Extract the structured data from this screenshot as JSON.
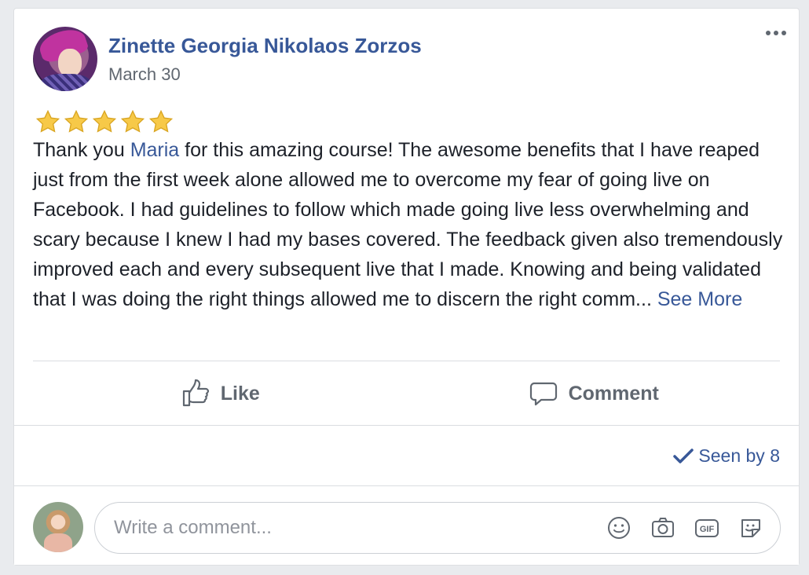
{
  "post": {
    "author": "Zinette Georgia Nikolaos Zorzos",
    "date": "March 30",
    "rating": 5,
    "text_before_mention": "Thank you ",
    "mention": "Maria",
    "text_after_mention": " for this amazing course! The awesome benefits that I have reaped just from the first week alone allowed me to overcome my fear of going live on Facebook. I had guidelines to follow which made going live less overwhelming and scary because I knew I had my bases covered. The feedback given also tremendously improved each and every subsequent live that I made. Knowing and being validated that I was doing the right things allowed me to discern the right comm...",
    "see_more": "See More",
    "menu_icon": "more-options-icon"
  },
  "actions": {
    "like_label": "Like",
    "comment_label": "Comment"
  },
  "seen": {
    "label": "Seen by 8"
  },
  "comment": {
    "placeholder": "Write a comment...",
    "value": ""
  },
  "colors": {
    "link": "#385898",
    "text": "#1d2129",
    "muted": "#606770",
    "star": "#f7c948",
    "background": "#e9ebee"
  }
}
